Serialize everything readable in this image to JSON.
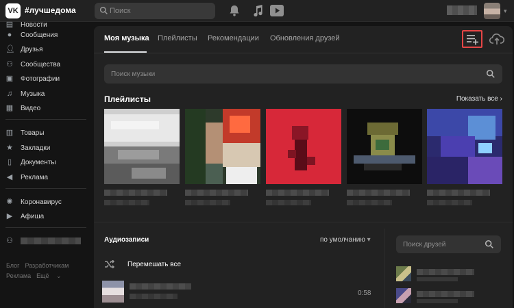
{
  "topbar": {
    "logo_text": "VK",
    "title": "#лучшедома",
    "search_placeholder": "Поиск"
  },
  "sidebar": {
    "items": [
      {
        "label": "Новости",
        "icon": "news-icon"
      },
      {
        "label": "Сообщения",
        "icon": "messages-icon"
      },
      {
        "label": "Друзья",
        "icon": "friends-icon"
      },
      {
        "label": "Сообщества",
        "icon": "communities-icon"
      },
      {
        "label": "Фотографии",
        "icon": "photos-icon"
      },
      {
        "label": "Музыка",
        "icon": "music-icon"
      },
      {
        "label": "Видео",
        "icon": "video-icon"
      },
      {
        "label": "Товары",
        "icon": "market-icon"
      },
      {
        "label": "Закладки",
        "icon": "bookmarks-icon"
      },
      {
        "label": "Документы",
        "icon": "documents-icon"
      },
      {
        "label": "Реклама",
        "icon": "ads-icon"
      },
      {
        "label": "Коронавирус",
        "icon": "coronavirus-icon"
      },
      {
        "label": "Афиша",
        "icon": "afisha-icon"
      }
    ],
    "footer": [
      "Блог",
      "Разработчикам",
      "Реклама",
      "Ещё"
    ]
  },
  "main": {
    "tabs": [
      {
        "label": "Моя музыка",
        "active": true
      },
      {
        "label": "Плейлисты",
        "active": false
      },
      {
        "label": "Рекомендации",
        "active": false
      },
      {
        "label": "Обновления друзей",
        "active": false
      }
    ],
    "music_search_placeholder": "Поиск музыки",
    "playlists_title": "Плейлисты",
    "show_all_label": "Показать все",
    "audio_title": "Аудиозаписи",
    "sort_label": "по умолчанию",
    "shuffle_label": "Перемешать все",
    "track": {
      "duration": "0:58"
    },
    "friends_search_placeholder": "Поиск друзей"
  },
  "colors": {
    "background": "#141414",
    "panel": "#222222",
    "highlight_border": "#e64646"
  }
}
